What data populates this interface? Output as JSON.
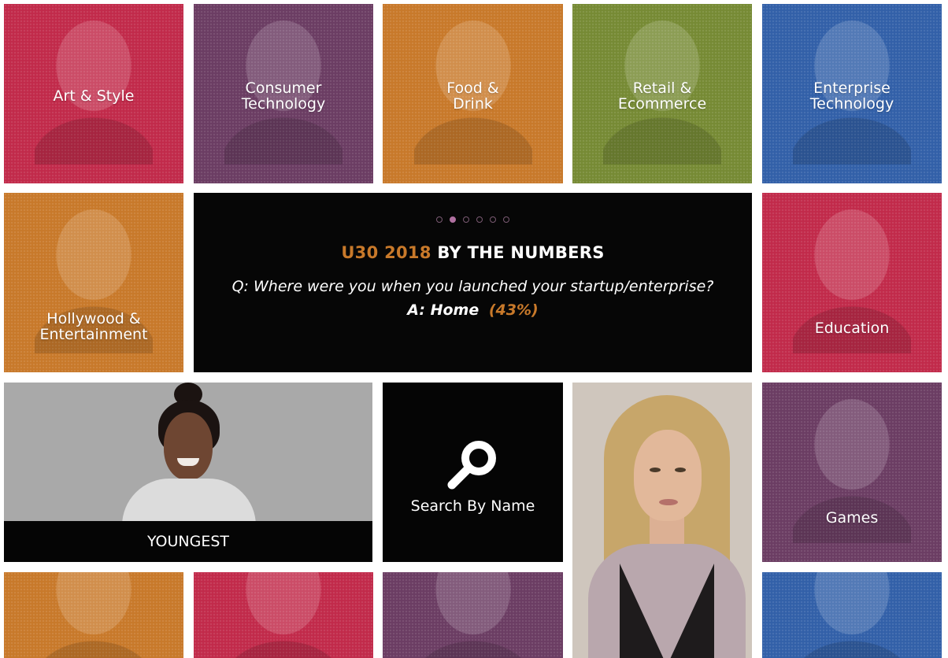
{
  "tiles": {
    "art_style": "Art & Style",
    "consumer_tech": "Consumer\nTechnology",
    "food_drink": "Food &\nDrink",
    "retail": "Retail &\nEcommerce",
    "enterprise_tech": "Enterprise\nTechnology",
    "hollywood": "Hollywood &\nEntertainment",
    "education": "Education",
    "games": "Games",
    "youngest": "YOUNGEST",
    "search": "Search By Name"
  },
  "numbers_panel": {
    "title_accent": "U30 2018",
    "title_rest": "BY THE NUMBERS",
    "question": "Q: Where were you when you launched your startup/enterprise?",
    "answer": "A: Home",
    "answer_pct": "(43%)",
    "active_dot": 2,
    "dot_count": 6
  },
  "colors": {
    "red": "#c12a4a",
    "purple": "#6b3d63",
    "orange": "#c8792a",
    "olive": "#768a34",
    "blue": "#3260a8",
    "panel": "#060606"
  }
}
